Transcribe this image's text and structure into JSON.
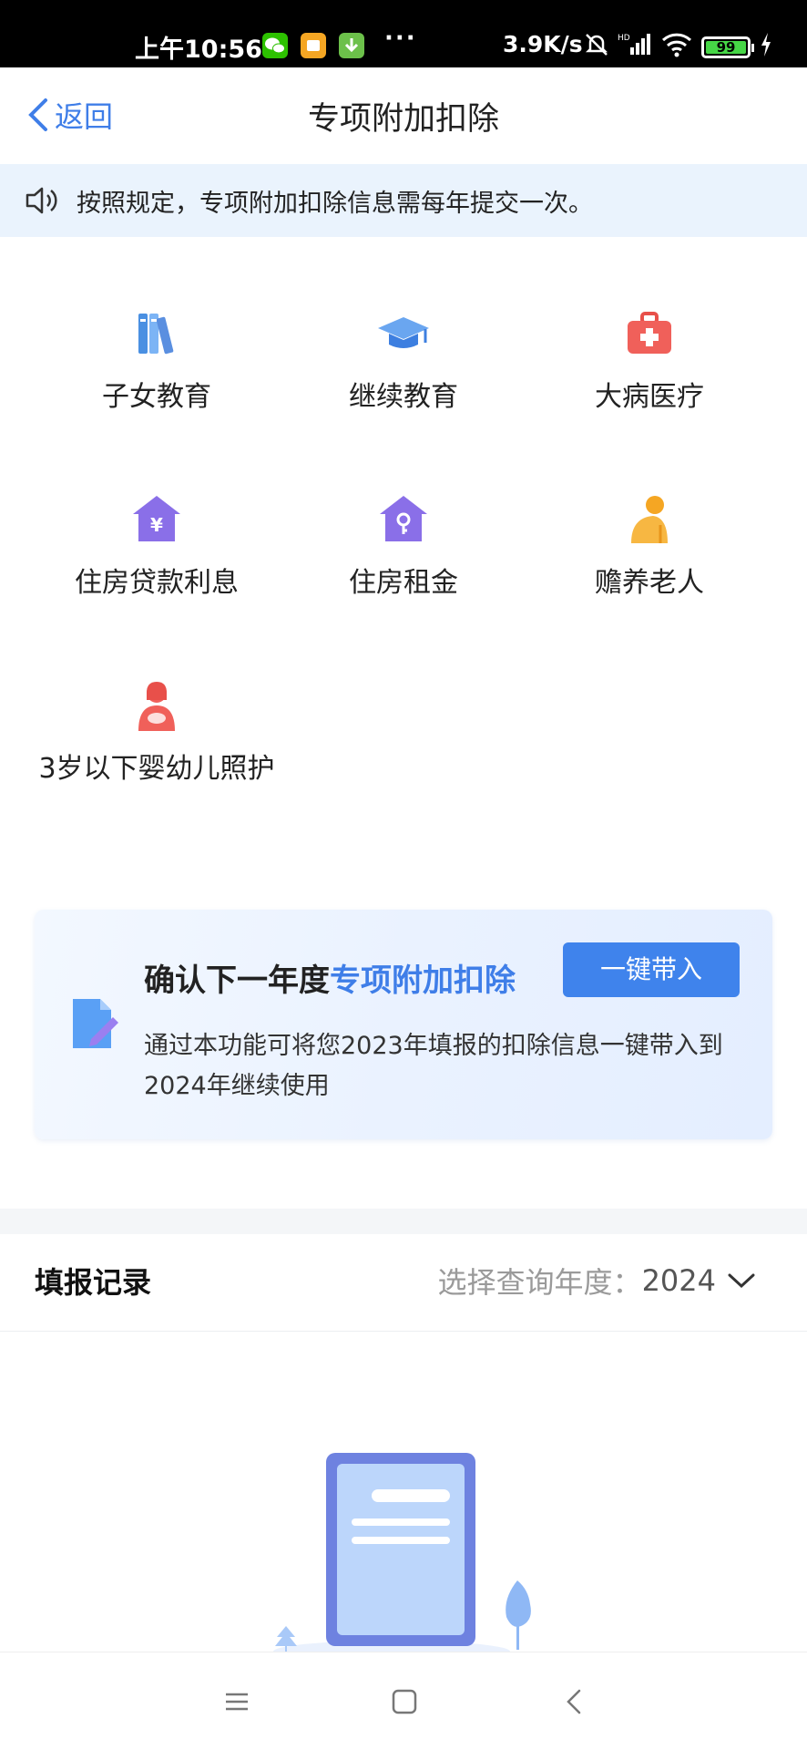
{
  "status_bar": {
    "time": "上午10:56",
    "app_icons": [
      "wechat-icon",
      "message-icon",
      "download-icon"
    ],
    "more": "···",
    "net_speed": "3.9K/s",
    "battery": "99"
  },
  "nav": {
    "back_label": "返回",
    "title": "专项附加扣除"
  },
  "notice": {
    "text": "按照规定，专项附加扣除信息需每年提交一次。"
  },
  "categories": [
    {
      "label": "子女教育",
      "icon": "books-icon"
    },
    {
      "label": "继续教育",
      "icon": "graduation-cap-icon"
    },
    {
      "label": "大病医疗",
      "icon": "medical-kit-icon"
    },
    {
      "label": "住房贷款利息",
      "icon": "house-yuan-icon"
    },
    {
      "label": "住房租金",
      "icon": "house-key-icon"
    },
    {
      "label": "赡养老人",
      "icon": "elderly-icon"
    },
    {
      "label": "3岁以下婴幼儿照护",
      "icon": "mother-child-icon"
    }
  ],
  "banner": {
    "title_prefix": "确认下一年度",
    "title_highlight": "专项附加扣除",
    "button": "一键带入",
    "description": "通过本功能可将您2023年填报的扣除信息一键带入到2024年继续使用"
  },
  "records": {
    "title": "填报记录",
    "year_label": "选择查询年度：",
    "year_value": "2024"
  },
  "colors": {
    "accent": "#3f7ee8",
    "notice_bg": "#eaf3fd",
    "button": "#3f83ec"
  }
}
